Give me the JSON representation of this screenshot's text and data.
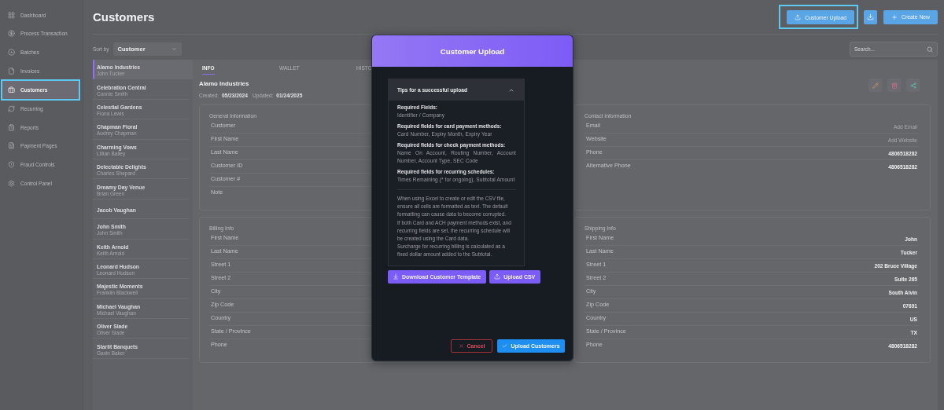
{
  "sidebar": {
    "items": [
      {
        "label": "Dashboard",
        "selected": false,
        "highlighted": false
      },
      {
        "label": "Process Transaction",
        "selected": false,
        "highlighted": false
      },
      {
        "label": "Batches",
        "selected": false,
        "highlighted": false
      },
      {
        "label": "Invoices",
        "selected": false,
        "highlighted": false
      },
      {
        "label": "Customers",
        "selected": true,
        "highlighted": true
      },
      {
        "label": "Recurring",
        "selected": false,
        "highlighted": false
      },
      {
        "label": "Reports",
        "selected": false,
        "highlighted": false
      },
      {
        "label": "Payment Pages",
        "selected": false,
        "highlighted": false
      },
      {
        "label": "Fraud Controls",
        "selected": false,
        "highlighted": false
      },
      {
        "label": "Control Panel",
        "selected": false,
        "highlighted": false
      }
    ]
  },
  "header": {
    "title": "Customers",
    "buttons": [
      {
        "kind": "upload",
        "label": "Customer Upload",
        "highlighted": true
      },
      {
        "kind": "download",
        "highlighted": false
      },
      {
        "kind": "create",
        "label": "Create New",
        "highlighted": false
      }
    ]
  },
  "sort": {
    "label": "Sort by",
    "value": "Customer"
  },
  "search": {
    "placeholder": "Search..."
  },
  "customers": [
    {
      "name": "Alamo Industries",
      "contact": "John Tucker",
      "selected": true
    },
    {
      "name": "Celebration Central",
      "contact": "Connie Smith",
      "selected": false
    },
    {
      "name": "Celestial Gardens",
      "contact": "Fiona Lewis",
      "selected": false
    },
    {
      "name": "Chapman Floral",
      "contact": "Audrey Chapman",
      "selected": false
    },
    {
      "name": "Charming Vows",
      "contact": "Lillian Bailey",
      "selected": false
    },
    {
      "name": "Delectable Delights",
      "contact": "Charles Shepard",
      "selected": false
    },
    {
      "name": "Dreamy Day Venue",
      "contact": "Brian Green",
      "selected": false
    },
    {
      "name": "Jacob Vaughan",
      "selected": false
    },
    {
      "name": "John Smith",
      "contact": "John Smith",
      "selected": false
    },
    {
      "name": "Keith Arnold",
      "contact": "Keith Arnold",
      "selected": false
    },
    {
      "name": "Leonard Hudson",
      "contact": "Leonard Hudson",
      "selected": false
    },
    {
      "name": "Majestic Moments",
      "contact": "Franklin Blackwell",
      "selected": false
    },
    {
      "name": "Michael Vaughan",
      "contact": "Michael Vaughan",
      "selected": false
    },
    {
      "name": "Oliver Slade",
      "contact": "Oliver Slade",
      "selected": false
    },
    {
      "name": "Starlit Banquets",
      "contact": "Gavin Baker",
      "selected": false
    }
  ],
  "detail": {
    "tabs": [
      {
        "label": "INFO",
        "selected": true
      },
      {
        "label": "WALLET",
        "selected": false
      },
      {
        "label": "HISTO",
        "selected": false
      }
    ],
    "title": "Alamo Industries",
    "created_label": "Created:",
    "created": "05/23/2024",
    "updated_label": "Updated:",
    "updated": "01/24/2025",
    "cards": [
      {
        "title": "General Information",
        "rows": [
          {
            "label": "Customer"
          },
          {
            "label": "First Name"
          },
          {
            "label": "Last Name"
          },
          {
            "label": "Customer ID"
          },
          {
            "label": "Customer #"
          },
          {
            "label": "Note"
          }
        ]
      },
      {
        "title": "Contact Information",
        "rows": [
          {
            "label": "Email",
            "value": "Add Email",
            "empty": true
          },
          {
            "label": "Website",
            "value": "Add Website",
            "empty": true
          },
          {
            "label": "Phone",
            "value": "4806518282",
            "empty": false
          },
          {
            "label": "Alternative Phone",
            "value": "4806518282",
            "empty": false
          }
        ]
      },
      {
        "title": "Billing Info",
        "rows": [
          {
            "label": "First Name"
          },
          {
            "label": "Last Name"
          },
          {
            "label": "Street 1"
          },
          {
            "label": "Street 2"
          },
          {
            "label": "City"
          },
          {
            "label": "Zip Code"
          },
          {
            "label": "Country"
          },
          {
            "label": "State / Province"
          },
          {
            "label": "Phone"
          }
        ]
      },
      {
        "title": "Shipping Info",
        "rows": [
          {
            "label": "First Name",
            "value": "John",
            "empty": false
          },
          {
            "label": "Last Name",
            "value": "Tucker",
            "empty": false
          },
          {
            "label": "Street 1",
            "value": "202 Bruce Village",
            "empty": false
          },
          {
            "label": "Street 2",
            "value": "Suite 265",
            "empty": false
          },
          {
            "label": "City",
            "value": "South Alvin",
            "empty": false
          },
          {
            "label": "Zip Code",
            "value": "07691",
            "empty": false
          },
          {
            "label": "Country",
            "value": "US",
            "empty": false
          },
          {
            "label": "State / Province",
            "value": "TX",
            "empty": false
          },
          {
            "label": "Phone",
            "value": "4806518282",
            "empty": false
          }
        ]
      }
    ]
  },
  "modal": {
    "title": "Customer Upload",
    "tips": {
      "title": "Tips for a successful upload",
      "expanded": true,
      "sections": [
        {
          "heading": "Required Fields:",
          "text": "Identifier / Company"
        },
        {
          "heading": "Required fields for card payment methods:",
          "text": "Card Number, Expiry Month, Expiry Year"
        },
        {
          "heading": "Required fields for check payment methods:",
          "text": "Name On Account, Routing Number, Account Number, Account Type, SEC Code"
        },
        {
          "heading": "Required fields for recurring schedules:",
          "text": "Times Remaining (* for ongoing), Subtotal Amount"
        }
      ],
      "notes": [
        "When using Excel to create or edit the CSV file, ensure all cells are formatted as text. The default formatting can cause data to become corrupted.",
        "If both Card and ACH payment methods exist, and recurring fields are set, the recurring schedule will be created using the Card data.",
        "Surcharge for recurring billing is calculated as a fixed dollar amount added to the Subtotal."
      ]
    },
    "actions": [
      {
        "kind": "template",
        "label": "Download Customer Template"
      },
      {
        "kind": "csv",
        "label": "Upload CSV"
      }
    ],
    "footer": [
      {
        "kind": "cancel",
        "label": "Cancel"
      },
      {
        "kind": "confirm",
        "label": "Upload Customers"
      }
    ]
  }
}
